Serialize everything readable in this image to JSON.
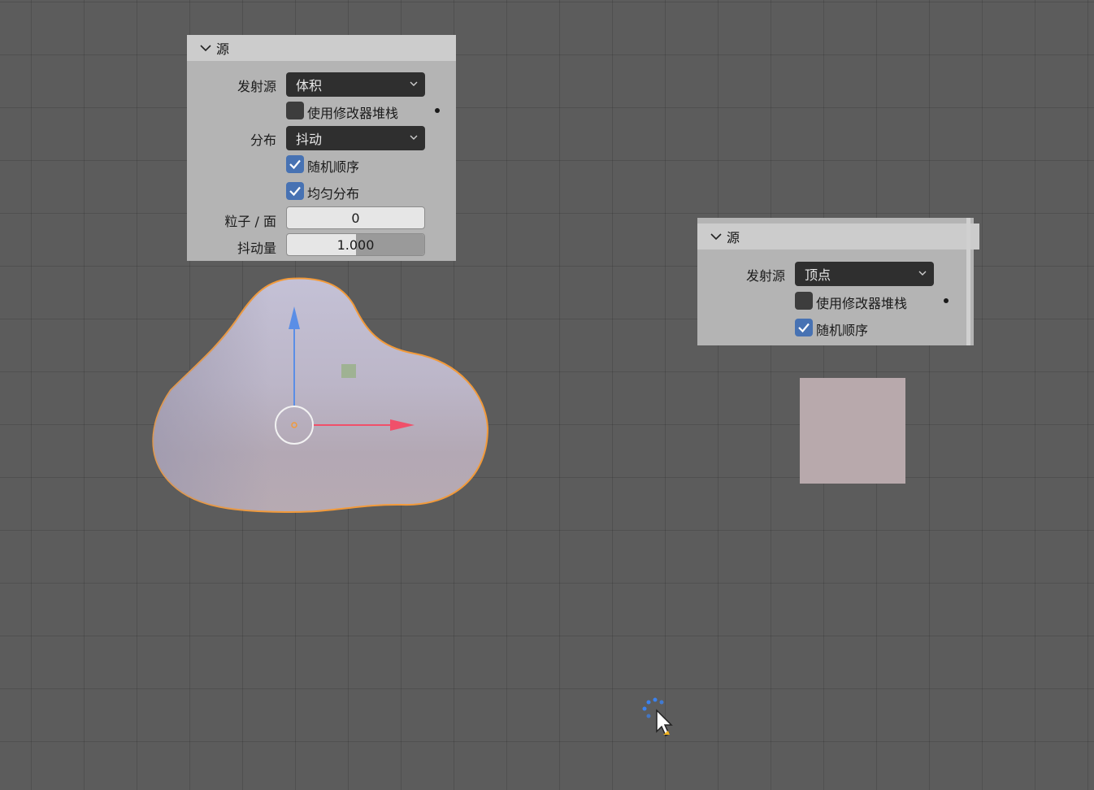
{
  "panel_left": {
    "title": "源",
    "emit_from_label": "发射源",
    "emit_from_value": "体积",
    "use_modifier_stack_label": "使用修改器堆栈",
    "use_modifier_stack_checked": false,
    "distribution_label": "分布",
    "distribution_value": "抖动",
    "random_order_label": "随机顺序",
    "random_order_checked": true,
    "even_distribution_label": "均匀分布",
    "even_distribution_checked": true,
    "particles_per_face_label": "粒子 / 面",
    "particles_per_face_value": "0",
    "jitter_amount_label": "抖动量",
    "jitter_amount_value": "1.000",
    "jitter_amount_fraction": 0.5
  },
  "panel_right": {
    "title": "源",
    "emit_from_label": "发射源",
    "emit_from_value": "顶点",
    "use_modifier_stack_label": "使用修改器堆栈",
    "use_modifier_stack_checked": false,
    "random_order_label": "随机顺序",
    "random_order_checked": true
  },
  "colors": {
    "viewport_bg": "#5c5c5c",
    "checkbox_on": "#4772b3",
    "selection_outline": "#f29a3a",
    "axis_z": "#5a8ee6",
    "axis_x": "#f0506a",
    "plane": "#b8a9ac",
    "cursor_spinner": "#3a82f0"
  },
  "icons": [
    "chevron-down-icon",
    "checkmark-icon",
    "keyframe-dot-icon",
    "mouse-pointer-icon",
    "busy-spinner-icon"
  ]
}
